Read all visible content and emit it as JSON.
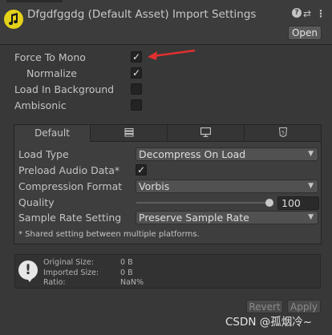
{
  "header": {
    "title": "Dfgdfggdg (Default Asset) Import Settings",
    "help_icon": "?",
    "settings_icon": "⇄",
    "menu_icon": "⋮",
    "open_label": "Open",
    "asset_icon": "audio-clip-icon",
    "accent_color": "#e4d21a"
  },
  "options": {
    "force_to_mono": {
      "label": "Force To Mono",
      "checked": true,
      "mark": "✓"
    },
    "normalize": {
      "label": "Normalize",
      "checked": true,
      "mark": "✓"
    },
    "load_in_background": {
      "label": "Load In Background",
      "checked": false
    },
    "ambisonic": {
      "label": "Ambisonic",
      "checked": false
    }
  },
  "platform_tabs": [
    {
      "label": "Default",
      "icon": null,
      "active": true
    },
    {
      "label": "",
      "icon": "standalone-icon",
      "active": false
    },
    {
      "label": "",
      "icon": "monitor-icon",
      "active": false
    },
    {
      "label": "",
      "icon": "webgl-icon",
      "active": false
    }
  ],
  "platform_settings": {
    "load_type": {
      "label": "Load Type",
      "value": "Decompress On Load"
    },
    "preload_audio_data": {
      "label": "Preload Audio Data*",
      "checked": true,
      "mark": "✓"
    },
    "compression_format": {
      "label": "Compression Format",
      "value": "Vorbis"
    },
    "quality": {
      "label": "Quality",
      "value": "100",
      "level": 1.0
    },
    "sample_rate_setting": {
      "label": "Sample Rate Setting",
      "value": "Preserve Sample Rate"
    },
    "note": "* Shared setting between multiple platforms."
  },
  "info": {
    "icon": "!",
    "original_size": {
      "label": "Original Size:",
      "value": "0 B"
    },
    "imported_size": {
      "label": "Imported Size:",
      "value": "0 B"
    },
    "ratio": {
      "label": "Ratio:",
      "value": "NaN%"
    }
  },
  "footer": {
    "revert_label": "Revert",
    "apply_label": "Apply"
  },
  "annotation": {
    "arrow_color": "#e03030"
  },
  "watermark": "CSDN @孤烟冷~"
}
